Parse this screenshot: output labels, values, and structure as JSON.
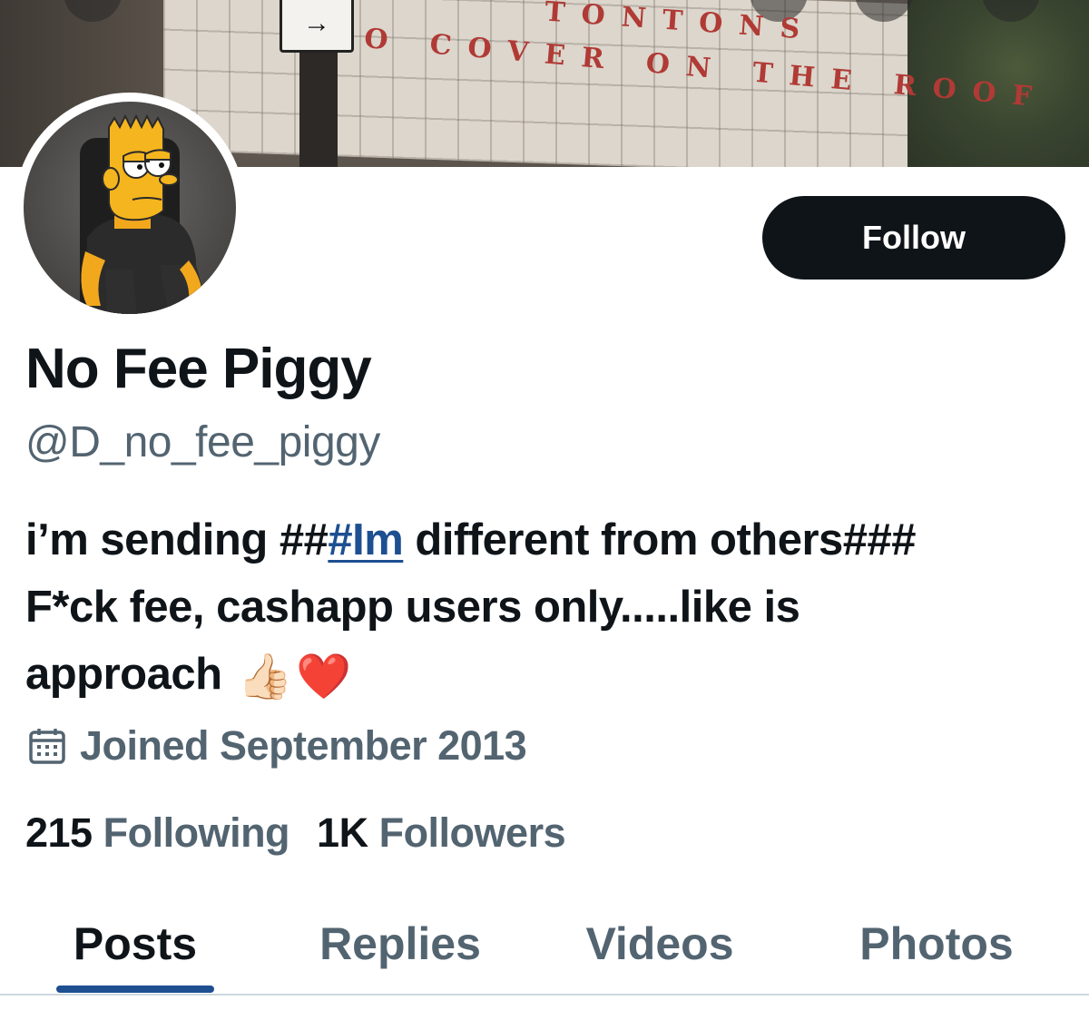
{
  "banner": {
    "sign_arrow": "→",
    "marquee_line_1": "TONTONS",
    "marquee_line_2": "O COVER ON THE ROOF"
  },
  "profile": {
    "display_name": "No Fee Piggy",
    "handle": "@D_no_fee_piggy",
    "follow_label": "Follow",
    "bio": {
      "part1": "i’m sending ##",
      "hashtag": "#Im",
      "part2": " different from others### F*ck fee, cashapp users only.....like is approach ",
      "emoji_1": "👍🏻",
      "emoji_2": "❤️"
    },
    "joined": "Joined September 2013",
    "joined_icon": "calendar-icon",
    "following_count": "215",
    "following_label": "Following",
    "followers_count": "1K",
    "followers_label": "Followers"
  },
  "tabs": [
    {
      "label": "Posts",
      "active": true
    },
    {
      "label": "Replies",
      "active": false
    },
    {
      "label": "Videos",
      "active": false
    },
    {
      "label": "Photos",
      "active": false
    }
  ],
  "colors": {
    "text_primary": "#0f1419",
    "text_secondary": "#536471",
    "link": "#1d4f91",
    "button_bg": "#0f1419",
    "button_text": "#ffffff",
    "tab_indicator": "#1d4f91"
  }
}
